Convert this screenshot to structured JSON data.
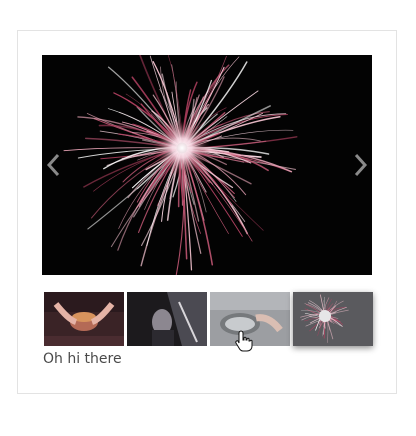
{
  "gallery": {
    "caption": "Oh hi there",
    "main_image": "fireworks-photo",
    "thumbnails": [
      {
        "image": "hands-holding-burger",
        "active": false
      },
      {
        "image": "person-in-car-dark",
        "active": false
      },
      {
        "image": "hand-on-car-mirror",
        "active": false
      },
      {
        "image": "fireworks-photo",
        "active": true
      }
    ]
  },
  "icons": {
    "prev": "chevron-left-icon",
    "next": "chevron-right-icon",
    "cursor": "hand-pointer-icon"
  }
}
